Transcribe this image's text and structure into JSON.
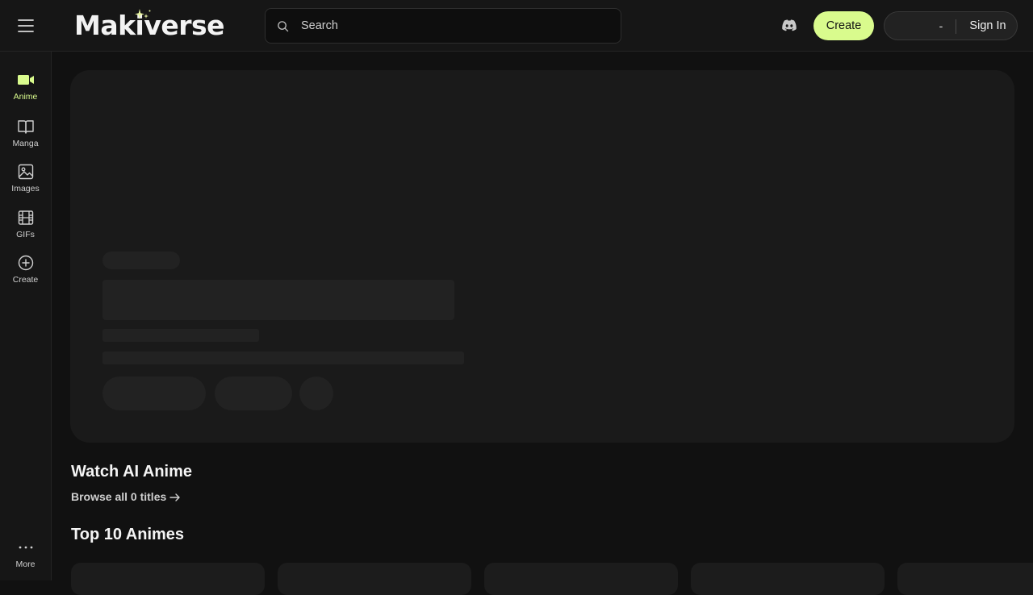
{
  "header": {
    "logo_text": "Makiverse",
    "search_placeholder": "Search",
    "create_label": "Create",
    "balance": "-",
    "signin_label": "Sign In"
  },
  "sidebar": {
    "items": [
      {
        "label": "Anime",
        "icon": "video-camera-icon",
        "active": true
      },
      {
        "label": "Manga",
        "icon": "book-open-icon"
      },
      {
        "label": "Images",
        "icon": "image-icon"
      },
      {
        "label": "GIFs",
        "icon": "film-icon"
      },
      {
        "label": "Create",
        "icon": "plus-circle-icon"
      }
    ],
    "more_label": "More"
  },
  "sections": {
    "watch_title": "Watch AI Anime",
    "browse_link": "Browse all 0 titles",
    "top_title": "Top 10 Animes"
  },
  "colors": {
    "accent": "#d9fb8d",
    "background": "#111111",
    "panel": "#161616"
  }
}
